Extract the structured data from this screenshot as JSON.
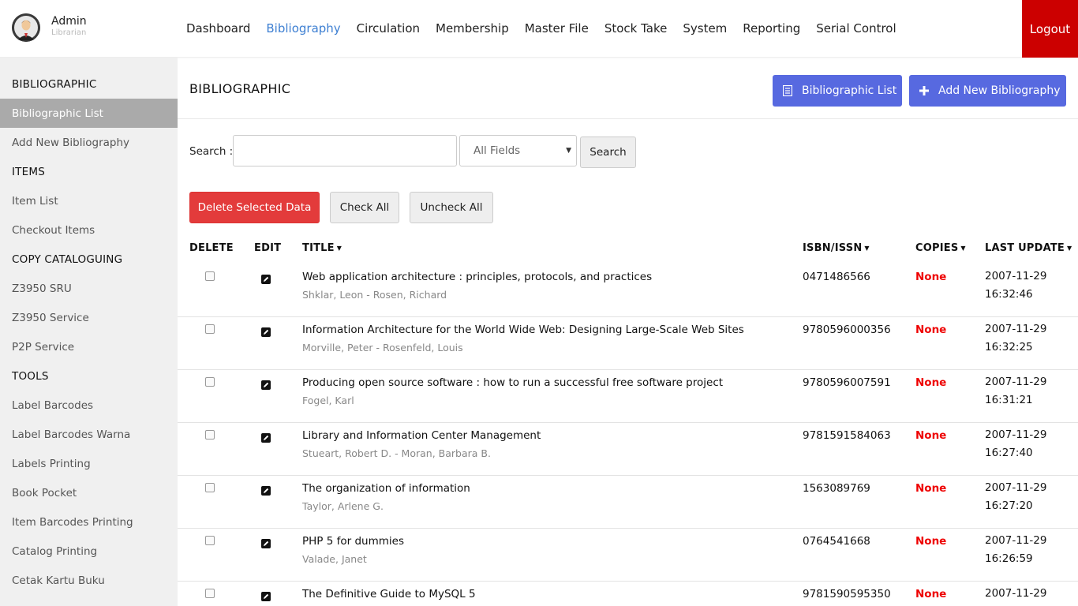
{
  "user": {
    "name": "Admin",
    "role": "Librarian"
  },
  "nav": [
    "Dashboard",
    "Bibliography",
    "Circulation",
    "Membership",
    "Master File",
    "Stock Take",
    "System",
    "Reporting",
    "Serial Control"
  ],
  "nav_active": "Bibliography",
  "logout_label": "Logout",
  "sidebar": [
    {
      "label": "BIBLIOGRAPHIC",
      "type": "head"
    },
    {
      "label": "Bibliographic List",
      "type": "item",
      "active": true
    },
    {
      "label": "Add New Bibliography",
      "type": "item"
    },
    {
      "label": "ITEMS",
      "type": "head"
    },
    {
      "label": "Item List",
      "type": "item"
    },
    {
      "label": "Checkout Items",
      "type": "item"
    },
    {
      "label": "COPY CATALOGUING",
      "type": "head"
    },
    {
      "label": "Z3950 SRU",
      "type": "item"
    },
    {
      "label": "Z3950 Service",
      "type": "item"
    },
    {
      "label": "P2P Service",
      "type": "item"
    },
    {
      "label": "TOOLS",
      "type": "head"
    },
    {
      "label": "Label Barcodes",
      "type": "item"
    },
    {
      "label": "Label Barcodes Warna",
      "type": "item"
    },
    {
      "label": "Labels Printing",
      "type": "item"
    },
    {
      "label": "Book Pocket",
      "type": "item"
    },
    {
      "label": "Item Barcodes Printing",
      "type": "item"
    },
    {
      "label": "Catalog Printing",
      "type": "item"
    },
    {
      "label": "Cetak Kartu Buku",
      "type": "item"
    }
  ],
  "main": {
    "title": "BIBLIOGRAPHIC",
    "list_button": "Bibliographic List",
    "add_button": "Add New Bibliography",
    "search_label": "Search :",
    "search_value": "",
    "field_select": "All Fields",
    "search_button": "Search",
    "delete_button": "Delete Selected Data",
    "check_all": "Check All",
    "uncheck_all": "Uncheck All",
    "columns": {
      "delete": "DELETE",
      "edit": "EDIT",
      "title": "TITLE",
      "isbn": "ISBN/ISSN",
      "copies": "COPIES",
      "last_update": "LAST UPDATE"
    }
  },
  "rows": [
    {
      "title": "Web application architecture : principles, protocols, and practices",
      "author": "Shklar, Leon - Rosen, Richard",
      "isbn": "0471486566",
      "copies": "None",
      "date": "2007-11-29",
      "time": "16:32:46"
    },
    {
      "title": "Information Architecture for the World Wide Web: Designing Large-Scale Web Sites",
      "author": "Morville, Peter - Rosenfeld, Louis",
      "isbn": "9780596000356",
      "copies": "None",
      "date": "2007-11-29",
      "time": "16:32:25"
    },
    {
      "title": "Producing open source software : how to run a successful free software project",
      "author": "Fogel, Karl",
      "isbn": "9780596007591",
      "copies": "None",
      "date": "2007-11-29",
      "time": "16:31:21"
    },
    {
      "title": "Library and Information Center Management",
      "author": "Stueart, Robert D. - Moran, Barbara B.",
      "isbn": "9781591584063",
      "copies": "None",
      "date": "2007-11-29",
      "time": "16:27:40"
    },
    {
      "title": "The organization of information",
      "author": "Taylor, Arlene G.",
      "isbn": "1563089769",
      "copies": "None",
      "date": "2007-11-29",
      "time": "16:27:20"
    },
    {
      "title": "PHP 5 for dummies",
      "author": "Valade, Janet",
      "isbn": "0764541668",
      "copies": "None",
      "date": "2007-11-29",
      "time": "16:26:59"
    },
    {
      "title": "The Definitive Guide to MySQL 5",
      "author": "",
      "isbn": "9781590595350",
      "copies": "None",
      "date": "2007-11-29",
      "time": ""
    }
  ],
  "colors": {
    "accent": "#5769e0",
    "nav_active": "#3d7fd2",
    "logout": "#cc0000",
    "danger": "#e33b3b",
    "none_text": "#ee0000"
  },
  "icons": {
    "list_button": "list-icon",
    "add_button": "plus-icon",
    "edit": "pencil-icon",
    "avatar": "user-avatar-icon"
  }
}
